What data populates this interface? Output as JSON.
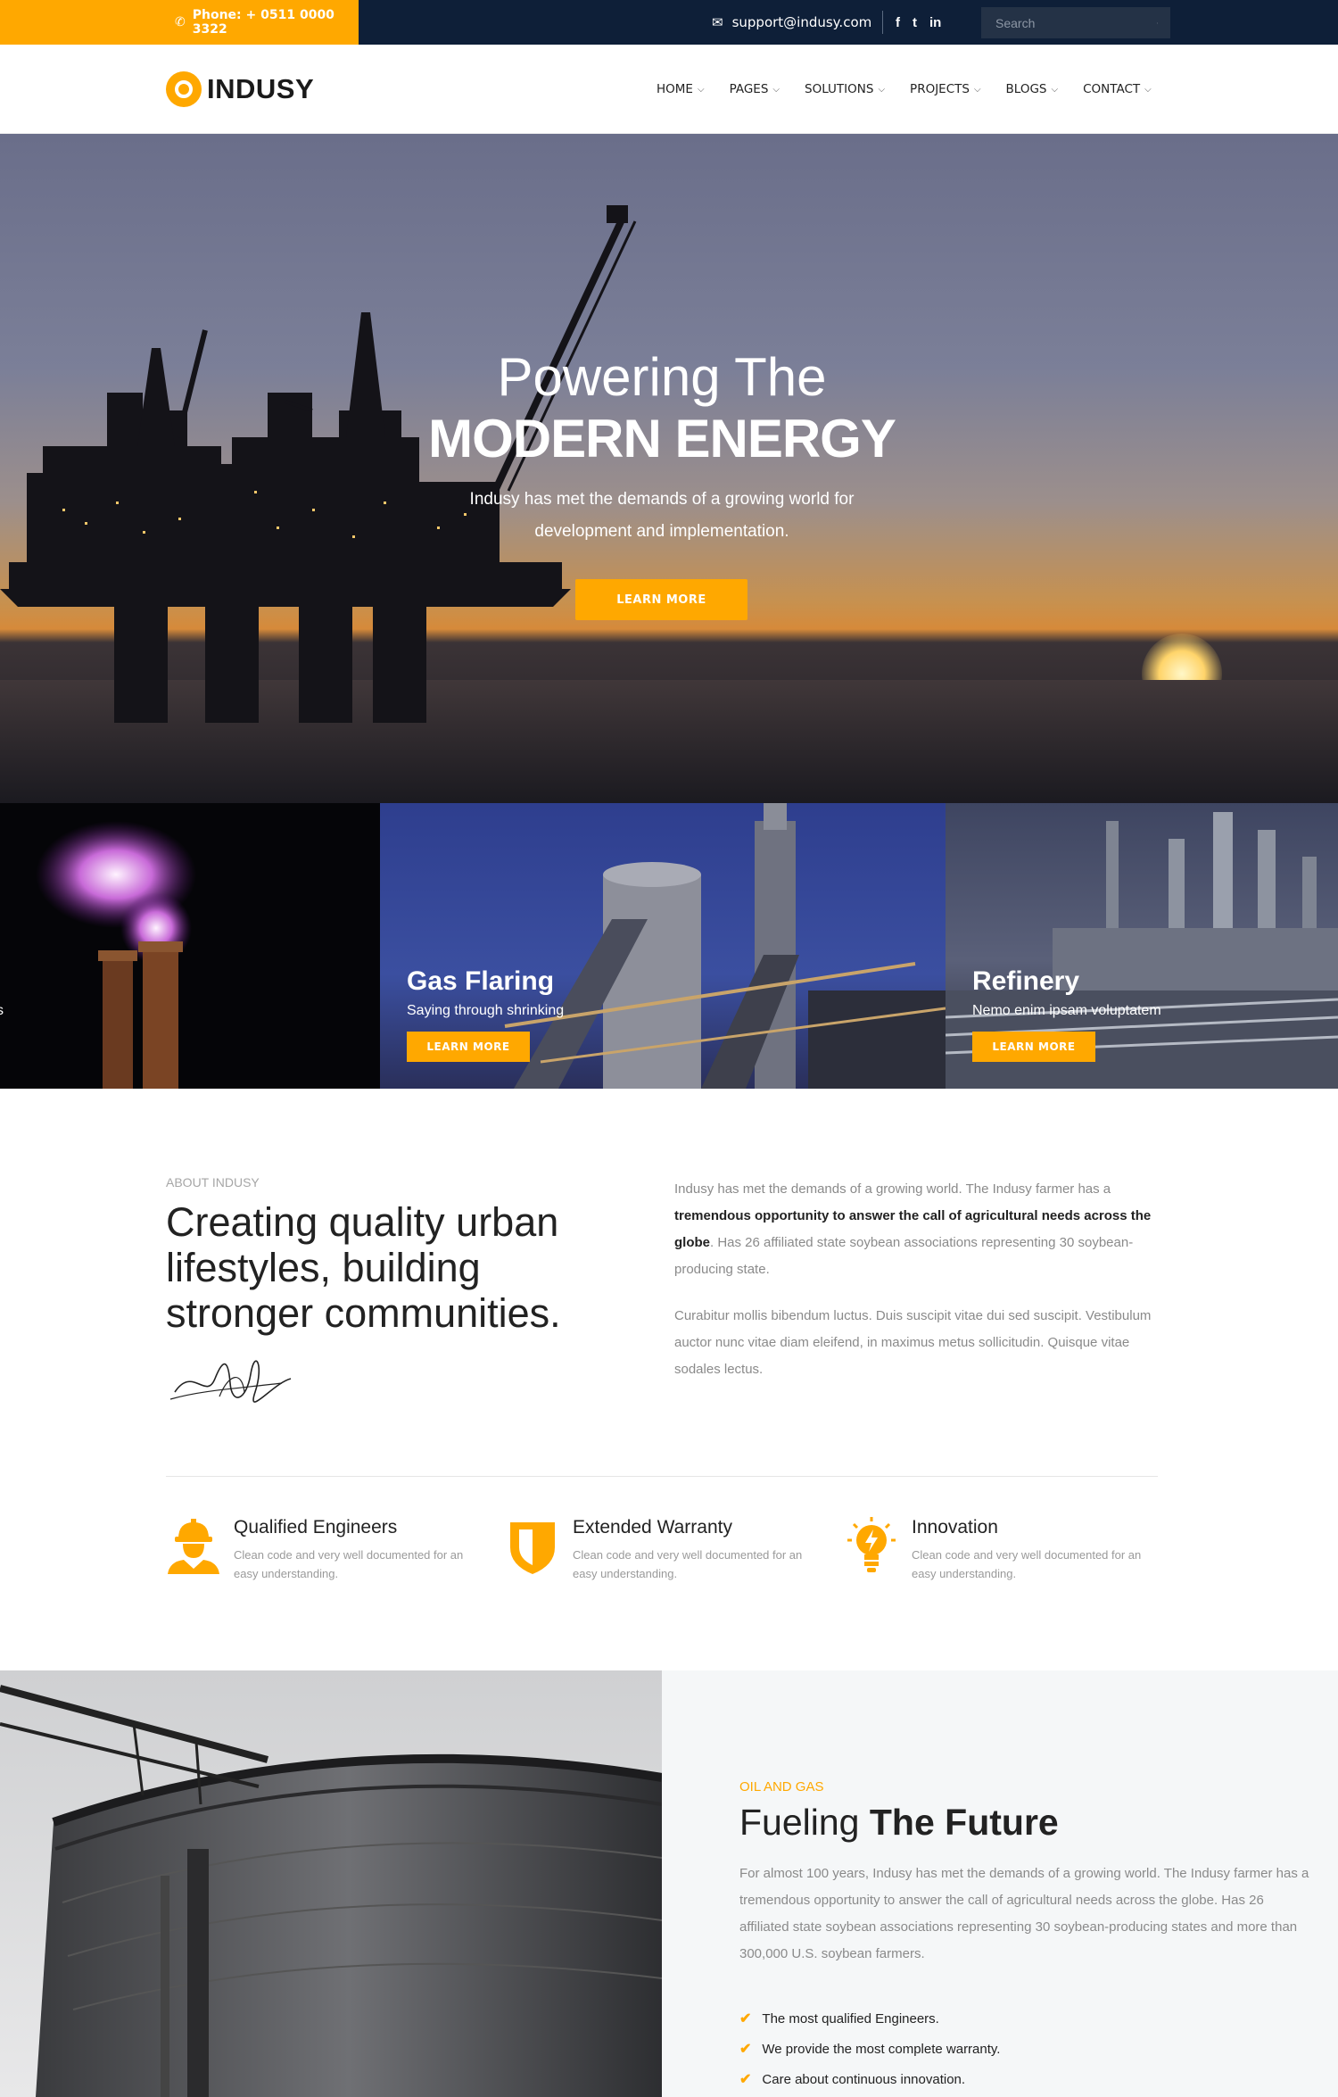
{
  "topbar": {
    "phone": "Phone: + 0511 0000 3322",
    "email": "support@indusy.com",
    "social": [
      "f",
      "t",
      "in"
    ],
    "search_placeholder": "Search"
  },
  "brand": {
    "name": "INDUSY"
  },
  "nav": {
    "items": [
      {
        "label": "HOME"
      },
      {
        "label": "PAGES"
      },
      {
        "label": "SOLUTIONS"
      },
      {
        "label": "PROJECTS"
      },
      {
        "label": "BLOGS"
      },
      {
        "label": "CONTACT"
      }
    ]
  },
  "hero": {
    "title_line1": "Powering The",
    "title_line2": "MODERN ENERGY",
    "subtitle": "Indusy has met the demands of a growing world for development and implementation.",
    "button": "LEARN MORE"
  },
  "services": [
    {
      "title": "",
      "desc": "s",
      "button": ""
    },
    {
      "title": "Gas Flaring",
      "desc": "Saying through shrinking",
      "button": "LEARN MORE"
    },
    {
      "title": "Refinery",
      "desc": "Nemo enim ipsam voluptatem",
      "button": "LEARN MORE"
    }
  ],
  "about": {
    "kicker": "ABOUT INDUSY",
    "heading": "Creating quality urban lifestyles, building stronger communities.",
    "p1_a": "Indusy has met the demands of a growing world. The Indusy farmer has a ",
    "p1_bold": "tremendous opportunity to answer the call of agricultural needs across the globe",
    "p1_b": ". Has 26 affiliated state soybean associations representing 30 soybean-producing state.",
    "p2": "Curabitur mollis bibendum luctus. Duis suscipit vitae dui sed suscipit. Vestibulum auctor nunc vitae diam eleifend, in maximus metus sollicitudin. Quisque vitae sodales lectus."
  },
  "features": [
    {
      "title": "Qualified Engineers",
      "desc": "Clean code and very well documented for an easy understanding.",
      "icon": "engineer-icon"
    },
    {
      "title": "Extended Warranty",
      "desc": "Clean code and very well documented for an easy understanding.",
      "icon": "shield-icon"
    },
    {
      "title": "Innovation",
      "desc": "Clean code and very well documented for an easy understanding.",
      "icon": "lightbulb-icon"
    }
  ],
  "fueling": {
    "kicker": "OIL AND GAS",
    "title_light": "Fueling ",
    "title_bold": "The Future",
    "paragraph": "For almost 100 years, Indusy has met the demands of a growing world. The Indusy farmer has a tremendous opportunity to answer the call of agricultural needs across the globe. Has 26 affiliated state soybean associations representing 30 soybean-producing states and more than 300,000 U.S. soybean farmers.",
    "checklist": [
      "The most qualified Engineers.",
      "We provide the most complete warranty.",
      "Care about continuous innovation."
    ]
  },
  "colors": {
    "accent": "#ffa800",
    "topbar": "#0e1f38"
  }
}
